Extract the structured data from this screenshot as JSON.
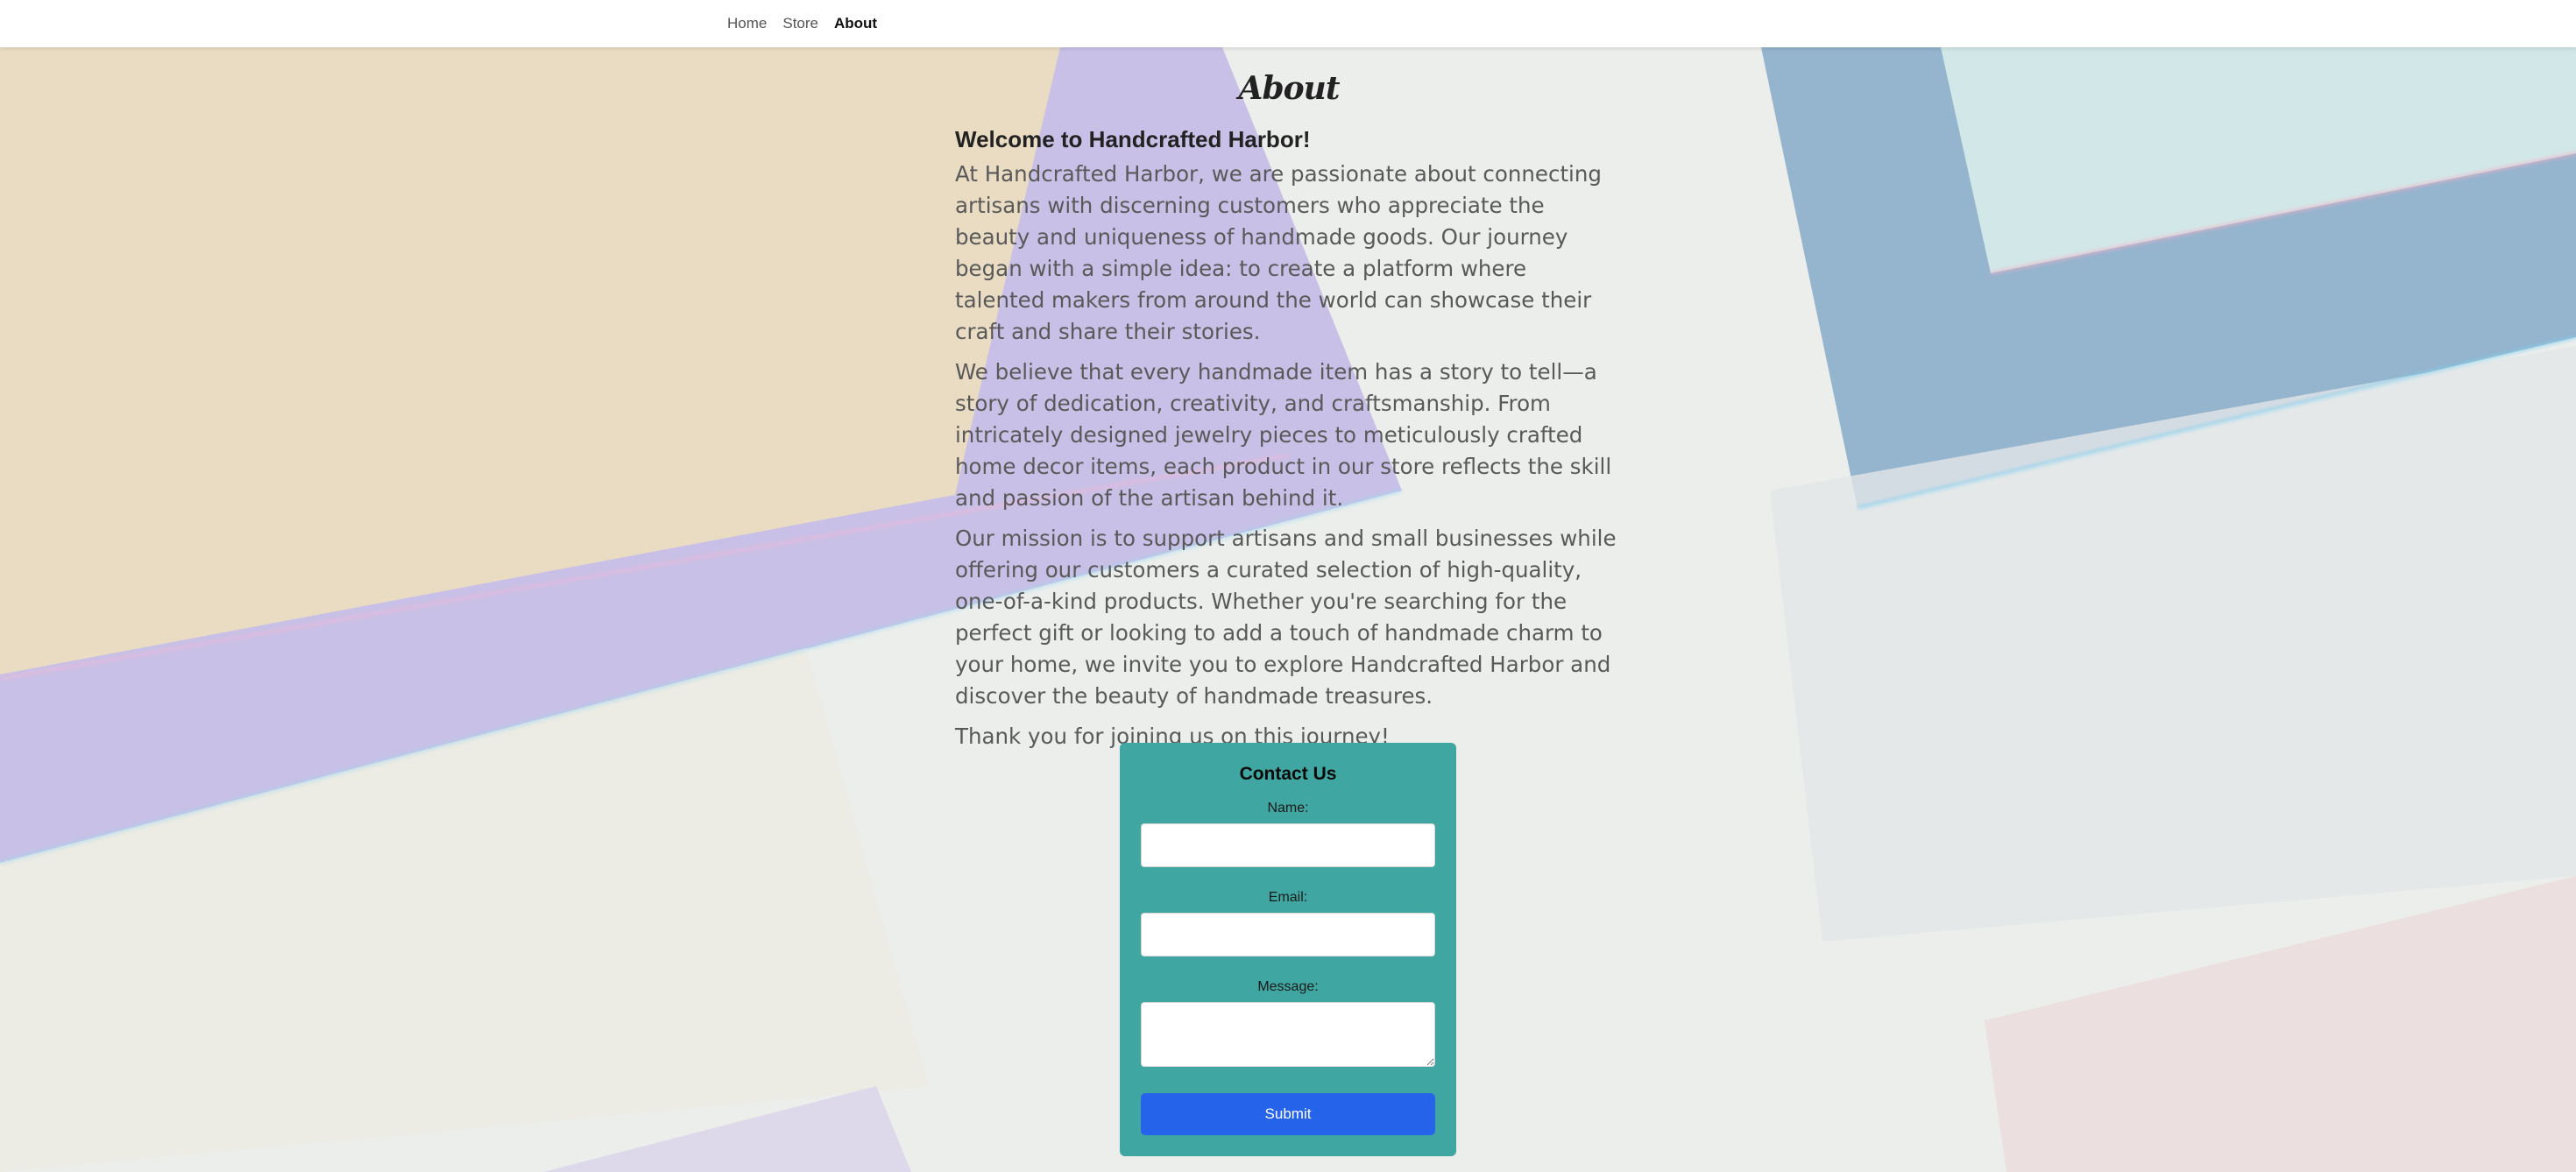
{
  "nav": {
    "items": [
      {
        "label": "Home",
        "active": false
      },
      {
        "label": "Store",
        "active": false
      },
      {
        "label": "About",
        "active": true
      }
    ]
  },
  "page": {
    "title": "About",
    "welcome_heading": "Welcome to Handcrafted Harbor!",
    "paragraphs": [
      "At Handcrafted Harbor, we are passionate about connecting artisans with discerning customers who appreciate the beauty and uniqueness of handmade goods. Our journey began with a simple idea: to create a platform where talented makers from around the world can showcase their craft and share their stories.",
      "We believe that every handmade item has a story to tell—a story of dedication, creativity, and craftsmanship. From intricately designed jewelry pieces to meticulously crafted home decor items, each product in our store reflects the skill and passion of the artisan behind it.",
      "Our mission is to support artisans and small businesses while offering our customers a curated selection of high-quality, one-of-a-kind products. Whether you're searching for the perfect gift or looking to add a touch of handmade charm to your home, we invite you to explore Handcrafted Harbor and discover the beauty of handmade treasures.",
      "Thank you for joining us on this journey!"
    ]
  },
  "contact": {
    "title": "Contact Us",
    "name_label": "Name:",
    "name_value": "",
    "email_label": "Email:",
    "email_value": "",
    "message_label": "Message:",
    "message_value": "",
    "submit_label": "Submit"
  },
  "colors": {
    "form_background": "#3fa6a1",
    "submit_button": "#2563eb",
    "nav_background": "#ffffff"
  }
}
